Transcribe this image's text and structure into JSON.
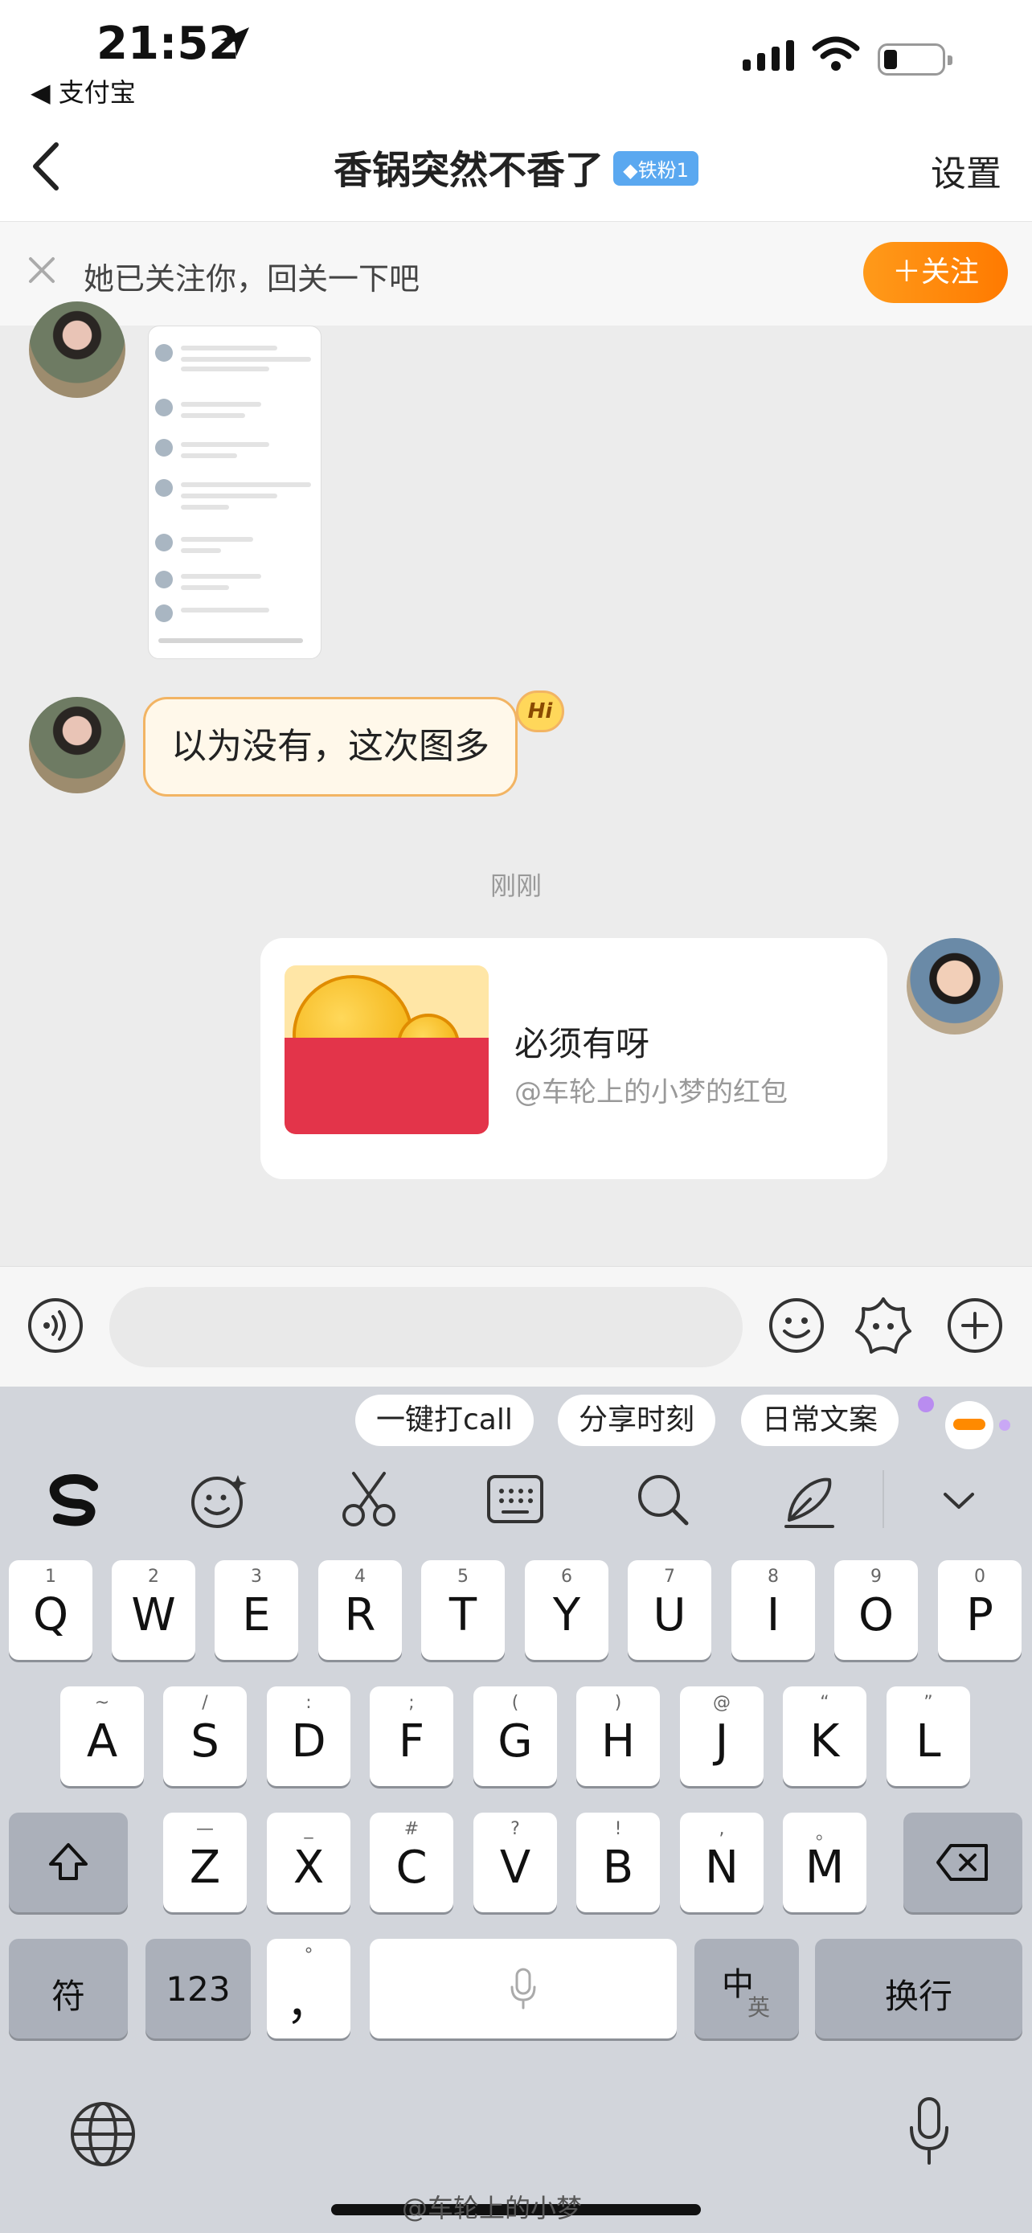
{
  "status_bar": {
    "time": "21:52",
    "back_app": "◀ 支付宝"
  },
  "nav": {
    "title": "香锅突然不香了",
    "fan_badge": "◆铁粉1",
    "settings": "设置"
  },
  "follow_banner": {
    "text": "她已关注你，回关一下吧",
    "button": "＋关注"
  },
  "chat": {
    "messages": [
      {
        "from": "her",
        "type": "image"
      },
      {
        "from": "her",
        "type": "text",
        "text": "以为没有，这次图多",
        "badge": "Hi"
      },
      {
        "type": "timestamp",
        "text": "刚刚"
      },
      {
        "from": "me",
        "type": "red_packet",
        "title": "必须有呀",
        "subtitle": "@车轮上的小梦的红包"
      }
    ]
  },
  "input_bar": {
    "placeholder": ""
  },
  "keyboard": {
    "suggestions": [
      "一键打call",
      "分享时刻",
      "日常文案"
    ],
    "row1": [
      {
        "sub": "1",
        "ch": "Q"
      },
      {
        "sub": "2",
        "ch": "W"
      },
      {
        "sub": "3",
        "ch": "E"
      },
      {
        "sub": "4",
        "ch": "R"
      },
      {
        "sub": "5",
        "ch": "T"
      },
      {
        "sub": "6",
        "ch": "Y"
      },
      {
        "sub": "7",
        "ch": "U"
      },
      {
        "sub": "8",
        "ch": "I"
      },
      {
        "sub": "9",
        "ch": "O"
      },
      {
        "sub": "0",
        "ch": "P"
      }
    ],
    "row2": [
      {
        "sub": "~",
        "ch": "A"
      },
      {
        "sub": "/",
        "ch": "S"
      },
      {
        "sub": ":",
        "ch": "D"
      },
      {
        "sub": ";",
        "ch": "F"
      },
      {
        "sub": "(",
        "ch": "G"
      },
      {
        "sub": ")",
        "ch": "H"
      },
      {
        "sub": "@",
        "ch": "J"
      },
      {
        "sub": "“",
        "ch": "K"
      },
      {
        "sub": "”",
        "ch": "L"
      }
    ],
    "row3": [
      {
        "sub": "—",
        "ch": "Z"
      },
      {
        "sub": "_",
        "ch": "X"
      },
      {
        "sub": "#",
        "ch": "C"
      },
      {
        "sub": "?",
        "ch": "V"
      },
      {
        "sub": "!",
        "ch": "B"
      },
      {
        "sub": ",",
        "ch": "N"
      },
      {
        "sub": "。",
        "ch": "M"
      }
    ],
    "row4": {
      "symbols": "符",
      "numbers": "123",
      "punct_sub": "°",
      "punct": "，",
      "lang": "中",
      "lang_alt": "英",
      "enter": "换行"
    }
  },
  "watermark": "@车轮上的小梦",
  "colors": {
    "follow_orange": "#ff8a00",
    "bubble_border": "#f2b463",
    "fan_badge": "#5aa8f0",
    "red_packet": "#e3344a"
  },
  "icons": [
    "location-arrow-icon",
    "signal-icon",
    "wifi-icon",
    "battery-icon",
    "back-chevron-icon",
    "close-icon",
    "voice-icon",
    "emoji-icon",
    "sticker-icon",
    "plus-icon",
    "sogou-logo-icon",
    "smile-sparkle-icon",
    "scissors-icon",
    "keyboard-icon",
    "search-icon",
    "pen-icon",
    "chevron-down-icon",
    "shift-icon",
    "delete-icon",
    "mic-icon",
    "globe-icon"
  ]
}
